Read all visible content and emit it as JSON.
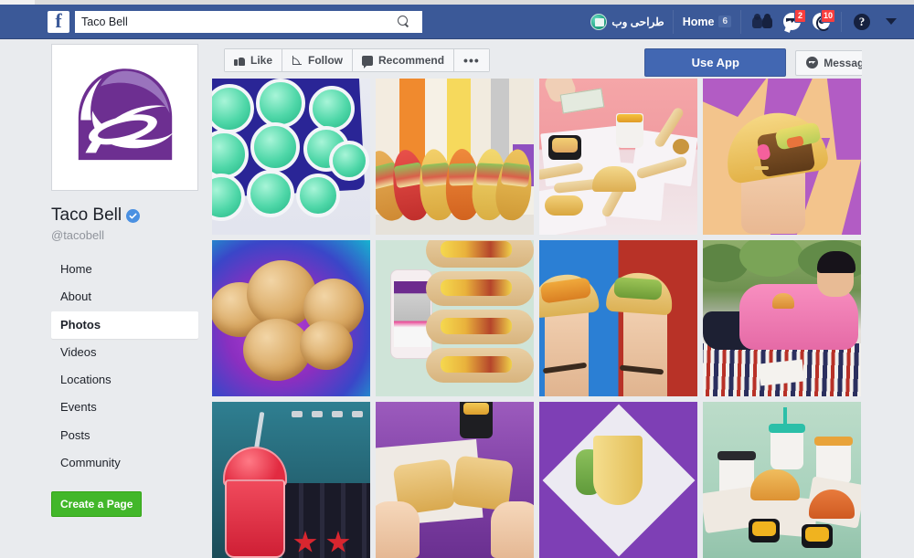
{
  "nav": {
    "logo_letter": "f",
    "search_value": "Taco Bell",
    "search_placeholder": "Search",
    "profile_name": "طراحی وب",
    "home_label": "Home",
    "home_count": "6",
    "messages_badge": "2",
    "notifications_badge": "10",
    "help_label": "?"
  },
  "profile": {
    "name": "Taco Bell",
    "handle": "@tacobell",
    "verified": true
  },
  "sidebar": {
    "items": [
      {
        "label": "Home",
        "active": false
      },
      {
        "label": "About",
        "active": false
      },
      {
        "label": "Photos",
        "active": true
      },
      {
        "label": "Videos",
        "active": false
      },
      {
        "label": "Locations",
        "active": false
      },
      {
        "label": "Events",
        "active": false
      },
      {
        "label": "Posts",
        "active": false
      },
      {
        "label": "Community",
        "active": false
      }
    ],
    "create_page_label": "Create a Page"
  },
  "actions": {
    "like_label": "Like",
    "follow_label": "Follow",
    "recommend_label": "Recommend",
    "more_label": "•••",
    "use_app_label": "Use App",
    "message_label": "Message"
  },
  "photos": [
    {
      "id": 1,
      "alt": "Green mint freeze cups arranged on a blue tray"
    },
    {
      "id": 2,
      "alt": "Row of crunchy tacos against a rainbow striped backdrop"
    },
    {
      "id": 3,
      "alt": "Breakfast spread with burritos and a dollar bill on pink"
    },
    {
      "id": 4,
      "alt": "Hand with pink nails holding a crunchy taco on purple zigzag"
    },
    {
      "id": 5,
      "alt": "Cinnamon sugar cinnabon delights on purple and teal"
    },
    {
      "id": 6,
      "alt": "Phone showing app beside stacked breakfast flatbreads on mint"
    },
    {
      "id": 7,
      "alt": "Two hands holding tacos against split blue and red background"
    },
    {
      "id": 8,
      "alt": "Man in pink shirt lying on picnic blanket holding a taco"
    },
    {
      "id": 9,
      "alt": "Red freeze drink beside punch cans on teal wall"
    },
    {
      "id": 10,
      "alt": "Hands breaking a quesadilla on purple background"
    },
    {
      "id": 11,
      "alt": "Taco on paper wrapper centered on purple background"
    },
    {
      "id": 12,
      "alt": "Party pack of tacos, chips and drinks on mint green"
    }
  ]
}
